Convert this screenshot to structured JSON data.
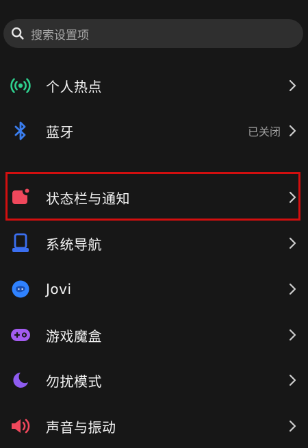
{
  "search": {
    "placeholder": "搜索设置项",
    "icon": "search-icon"
  },
  "items": [
    {
      "label": "个人热点",
      "icon": "hotspot-icon",
      "value": ""
    },
    {
      "label": "蓝牙",
      "icon": "bluetooth-icon",
      "value": "已关闭"
    },
    {
      "label": "状态栏与通知",
      "icon": "notification-icon",
      "value": "",
      "highlighted": true
    },
    {
      "label": "系统导航",
      "icon": "navigation-icon",
      "value": ""
    },
    {
      "label": "Jovi",
      "icon": "jovi-icon",
      "value": ""
    },
    {
      "label": "游戏魔盒",
      "icon": "gamepad-icon",
      "value": ""
    },
    {
      "label": "勿扰模式",
      "icon": "moon-icon",
      "value": ""
    },
    {
      "label": "声音与振动",
      "icon": "speaker-icon",
      "value": ""
    }
  ],
  "colors": {
    "background": "#171717",
    "highlight_border": "#d20f0f",
    "hotspot": "#2fd08f",
    "bluetooth": "#3a7ef0",
    "notification": "#f0485c",
    "navigation": "#3b6ff0",
    "jovi": "#2f82ff",
    "gamepad": "#a35cf0",
    "moon": "#8e5cf0",
    "speaker": "#f0485c"
  }
}
